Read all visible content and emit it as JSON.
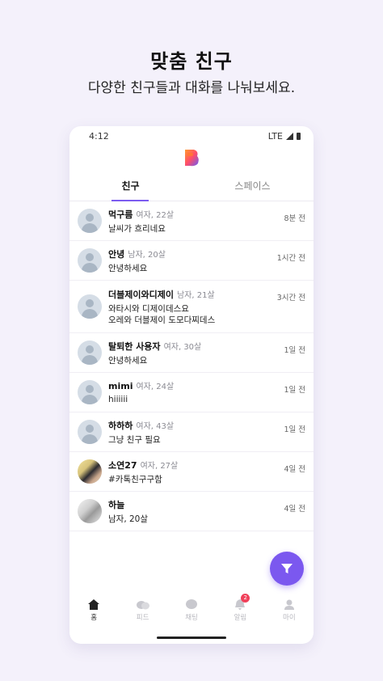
{
  "promo": {
    "title": "맞춤 친구",
    "subtitle": "다양한 친구들과 대화를 나눠보세요."
  },
  "status_bar": {
    "time": "4:12",
    "network": "LTE"
  },
  "tabs": [
    {
      "label": "친구",
      "active": true
    },
    {
      "label": "스페이스",
      "active": false
    }
  ],
  "friends": [
    {
      "name": "먹구름",
      "meta": "여자, 22살",
      "message": "날씨가 흐리네요",
      "time": "8분 전"
    },
    {
      "name": "안녕",
      "meta": "남자, 20살",
      "message": "안녕하세요",
      "time": "1시간 전"
    },
    {
      "name": "더블제이와디제이",
      "meta": "남자, 21살",
      "message": "와타시와 디제이데스요\n오레와 더블제이 도모다찌데스",
      "time": "3시간 전"
    },
    {
      "name": "탈퇴한 사용자",
      "meta": "여자, 30살",
      "message": "안녕하세요",
      "time": "1일 전"
    },
    {
      "name": "mimi",
      "meta": "여자, 24살",
      "message": "hiiiiii",
      "time": "1일 전"
    },
    {
      "name": "하하하",
      "meta": "여자, 43살",
      "message": "그냥 친구 필요",
      "time": "1일 전"
    },
    {
      "name": "소연27",
      "meta": "여자, 27살",
      "message": "#카톡친구구함",
      "time": "4일 전"
    },
    {
      "name": "하늘",
      "meta": "",
      "message": "남자, 20살",
      "time": "4일 전"
    }
  ],
  "bottom_nav": [
    {
      "label": "홈",
      "icon": "home-icon",
      "active": true
    },
    {
      "label": "피드",
      "icon": "feed-icon",
      "active": false
    },
    {
      "label": "채팅",
      "icon": "chat-icon",
      "active": false
    },
    {
      "label": "알림",
      "icon": "bell-icon",
      "active": false,
      "badge": "2"
    },
    {
      "label": "마이",
      "icon": "person-icon",
      "active": false
    }
  ],
  "colors": {
    "accent": "#7b58ef",
    "badge": "#f0405a",
    "background": "#f4f1fb"
  }
}
